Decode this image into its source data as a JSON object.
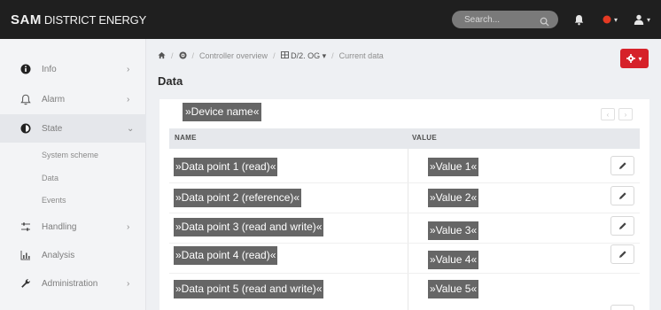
{
  "brand": {
    "strong": "SAM",
    "rest": "DISTRICT ENERGY"
  },
  "topbar": {
    "search_placeholder": "Search..."
  },
  "sidebar": {
    "items": [
      {
        "label": "Info",
        "icon": "info-icon",
        "chevron": "›"
      },
      {
        "label": "Alarm",
        "icon": "bell-icon",
        "chevron": "›"
      },
      {
        "label": "State",
        "icon": "half-circle-icon",
        "chevron": "⌄"
      },
      {
        "label": "Handling",
        "icon": "sliders-icon",
        "chevron": "›"
      },
      {
        "label": "Analysis",
        "icon": "chart-icon",
        "chevron": "›"
      },
      {
        "label": "Administration",
        "icon": "wrench-icon",
        "chevron": "›"
      }
    ],
    "sub_items": [
      "System scheme",
      "Data",
      "Events"
    ]
  },
  "breadcrumb": {
    "home": "home-icon",
    "gauge": "gauge-icon",
    "controller": "Controller overview",
    "device": "D/2. OG",
    "current": "Current data",
    "sep": "/"
  },
  "page": {
    "title": "Data"
  },
  "card": {
    "device_name": "»Device name«",
    "columns": {
      "name": "NAME",
      "value": "VALUE"
    },
    "rows": [
      {
        "name": "»Data point 1 (read)«",
        "value": "»Value 1«"
      },
      {
        "name": "»Data point 2 (reference)«",
        "value": "»Value 2«"
      },
      {
        "name": "»Data point 3 (read and write)«",
        "value": "»Value 3«"
      },
      {
        "name": "»Data point 4 (read)«",
        "value": "»Value 4«"
      },
      {
        "name": "»Data point 5 (read and write)«",
        "value": "»Value 5«"
      }
    ],
    "pager_prev": "‹",
    "pager_next": "›"
  },
  "colors": {
    "accent": "#d6222a",
    "topbar": "#1f1f1f",
    "tag": "#666666"
  }
}
